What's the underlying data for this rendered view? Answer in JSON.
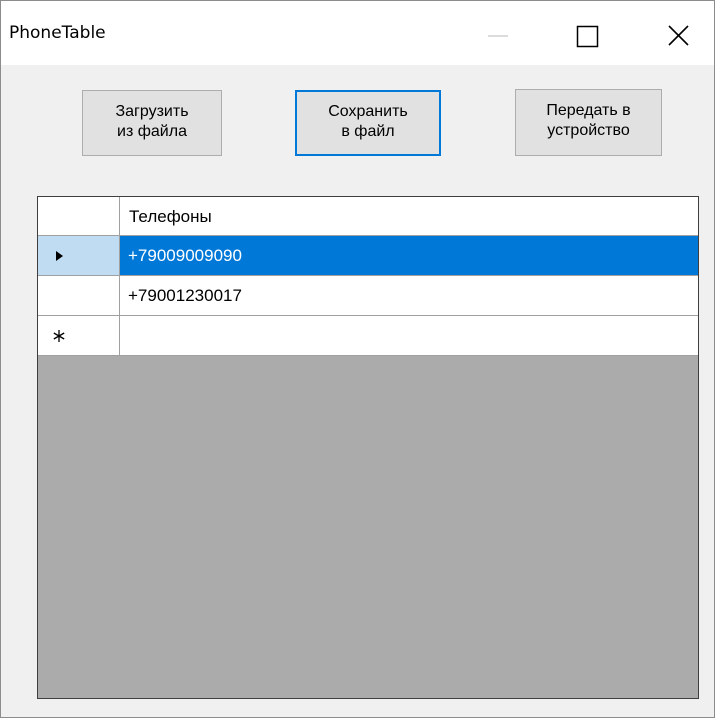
{
  "window": {
    "title": "PhoneTable"
  },
  "titlebar_icons": {
    "minimize": "minimize-icon",
    "maximize": "maximize-icon",
    "close": "close-icon"
  },
  "toolbar": {
    "load_label": "Загрузить\nиз файла",
    "save_label": "Сохранить\nв файл",
    "send_label": "Передать в\nустройство"
  },
  "grid": {
    "column_header": "Телефоны",
    "rows": [
      {
        "phone": "+79009009090",
        "selected": true,
        "indicator": "current-row-arrow-icon"
      },
      {
        "phone": "+79001230017",
        "selected": false,
        "indicator": ""
      },
      {
        "phone": "",
        "selected": false,
        "indicator": "new-row-asterisk-icon"
      }
    ]
  },
  "colors": {
    "selection": "#0078d7",
    "row_header_selected": "#c0dcf3",
    "grid_background": "#ababab",
    "focus_border": "#0078d7"
  }
}
